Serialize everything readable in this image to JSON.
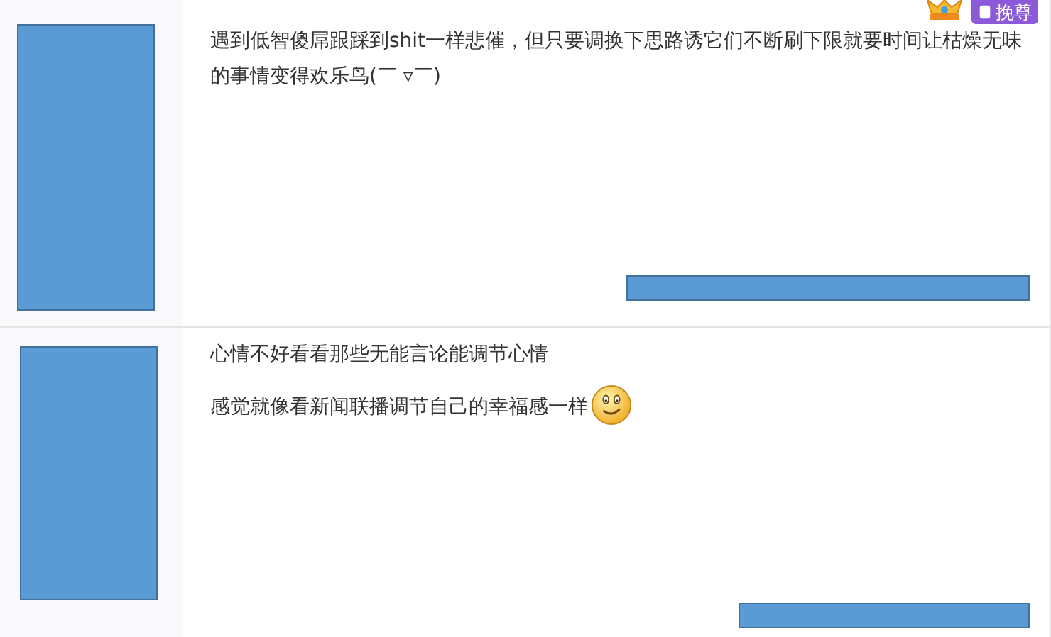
{
  "posts": [
    {
      "lines": [
        "遇到低智傻屌跟踩到shit一样悲催，但只要调换下思路诱它们不断刷下限就要时间让枯燥无味的事情变得欢乐鸟(￣ ▿￣)"
      ],
      "emoticon": false,
      "badge": "挽尊",
      "crown": true
    },
    {
      "lines": [
        "心情不好看看那些无能言论能调节心情",
        "感觉就像看新闻联播调节自己的幸福感一样"
      ],
      "emoticon": true,
      "crown": false
    }
  ]
}
